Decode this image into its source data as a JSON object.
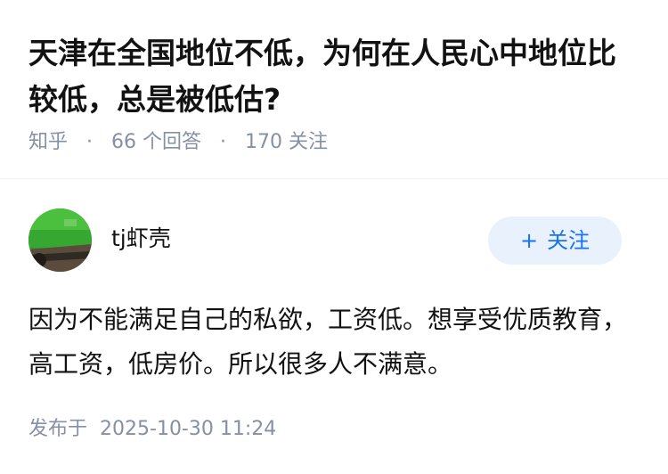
{
  "question": {
    "title": "天津在全国地位不低，为何在人民心中地位比较低，总是被低估?",
    "source": "知乎",
    "answer_count": "66 个回答",
    "follower_count": "170 关注",
    "separator": "·"
  },
  "answer": {
    "author_name": "tj虾壳",
    "follow_plus": "+",
    "follow_label": "关注",
    "content": "因为不能满足自己的私欲，工资低。想享受优质教育，高工资，低房价。所以很多人不满意。",
    "published_label": "发布于",
    "published_time": "2025-10-30 11:24"
  },
  "colors": {
    "meta_gray": "#8590a6",
    "accent_blue": "#1772f6",
    "follow_bg": "#e8f1fc"
  },
  "icons": {
    "avatar": "avatar-image"
  }
}
